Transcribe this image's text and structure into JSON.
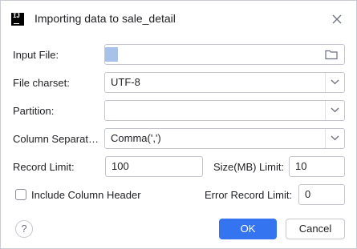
{
  "dialog": {
    "title": "Importing data to sale_detail",
    "app_icon_text": "IJ"
  },
  "form": {
    "input_file": {
      "label": "Input File:",
      "value": ""
    },
    "file_charset": {
      "label": "File charset:",
      "value": "UTF-8"
    },
    "partition": {
      "label": "Partition:",
      "value": ""
    },
    "column_separator": {
      "label": "Column Separat…",
      "value": "Comma(',')"
    },
    "record_limit": {
      "label": "Record Limit:",
      "value": "100"
    },
    "size_limit": {
      "label": "Size(MB) Limit:",
      "value": "10"
    },
    "include_header": {
      "label": "Include Column Header",
      "checked": false
    },
    "error_record_limit": {
      "label": "Error Record Limit:",
      "value": "0"
    }
  },
  "buttons": {
    "help": "?",
    "ok": "OK",
    "cancel": "Cancel"
  },
  "icons": {
    "close": "close-icon",
    "folder": "folder-icon",
    "dropdown": "chevron-down-icon"
  },
  "colors": {
    "accent": "#3574f0",
    "selection": "#a6c2e8"
  }
}
